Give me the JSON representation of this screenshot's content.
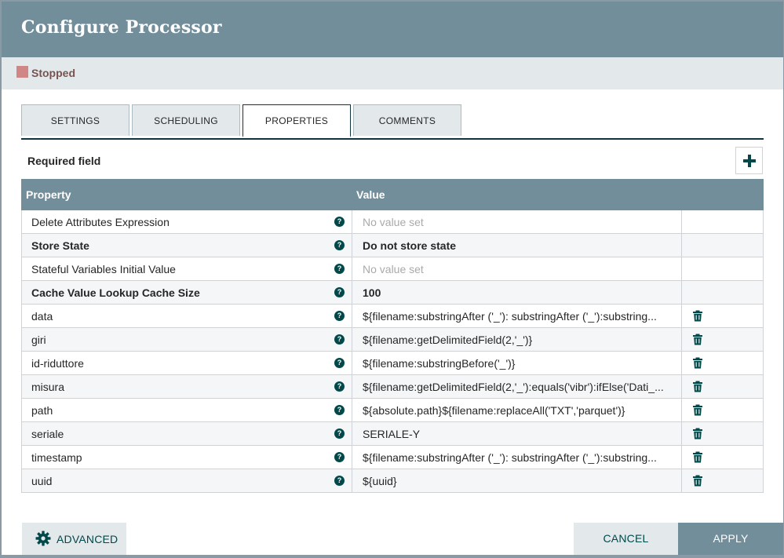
{
  "dialog": {
    "title": "Configure Processor",
    "status": "Stopped",
    "status_color": "#d18686",
    "header_color": "#728e9b"
  },
  "tabs": [
    {
      "label": "SETTINGS",
      "active": false
    },
    {
      "label": "SCHEDULING",
      "active": false
    },
    {
      "label": "PROPERTIES",
      "active": true
    },
    {
      "label": "COMMENTS",
      "active": false
    }
  ],
  "properties": {
    "required_label": "Required field",
    "add_icon": "plus-icon",
    "columns": {
      "property": "Property",
      "value": "Value"
    },
    "rows": [
      {
        "name": "Delete Attributes Expression",
        "value": "No value set",
        "required": false,
        "unset": true,
        "deletable": false
      },
      {
        "name": "Store State",
        "value": "Do not store state",
        "required": true,
        "unset": false,
        "deletable": false
      },
      {
        "name": "Stateful Variables Initial Value",
        "value": "No value set",
        "required": false,
        "unset": true,
        "deletable": false
      },
      {
        "name": "Cache Value Lookup Cache Size",
        "value": "100",
        "required": true,
        "unset": false,
        "deletable": false
      },
      {
        "name": "data",
        "value": "${filename:substringAfter ('_'): substringAfter ('_'):substring...",
        "required": false,
        "unset": false,
        "deletable": true
      },
      {
        "name": "giri",
        "value": "${filename:getDelimitedField(2,'_')}",
        "required": false,
        "unset": false,
        "deletable": true
      },
      {
        "name": "id-riduttore",
        "value": "${filename:substringBefore('_')}",
        "required": false,
        "unset": false,
        "deletable": true
      },
      {
        "name": "misura",
        "value": "${filename:getDelimitedField(2,'_'):equals('vibr'):ifElse('Dati_...",
        "required": false,
        "unset": false,
        "deletable": true
      },
      {
        "name": "path",
        "value": "${absolute.path}${filename:replaceAll('TXT','parquet')}",
        "required": false,
        "unset": false,
        "deletable": true
      },
      {
        "name": "seriale",
        "value": "SERIALE-Y",
        "required": false,
        "unset": false,
        "deletable": true
      },
      {
        "name": "timestamp",
        "value": "${filename:substringAfter ('_'): substringAfter ('_'):substring...",
        "required": false,
        "unset": false,
        "deletable": true
      },
      {
        "name": "uuid",
        "value": "${uuid}",
        "required": false,
        "unset": false,
        "deletable": true
      }
    ]
  },
  "footer": {
    "advanced_label": "ADVANCED",
    "advanced_icon": "gear-icon",
    "cancel_label": "CANCEL",
    "apply_label": "APPLY"
  }
}
